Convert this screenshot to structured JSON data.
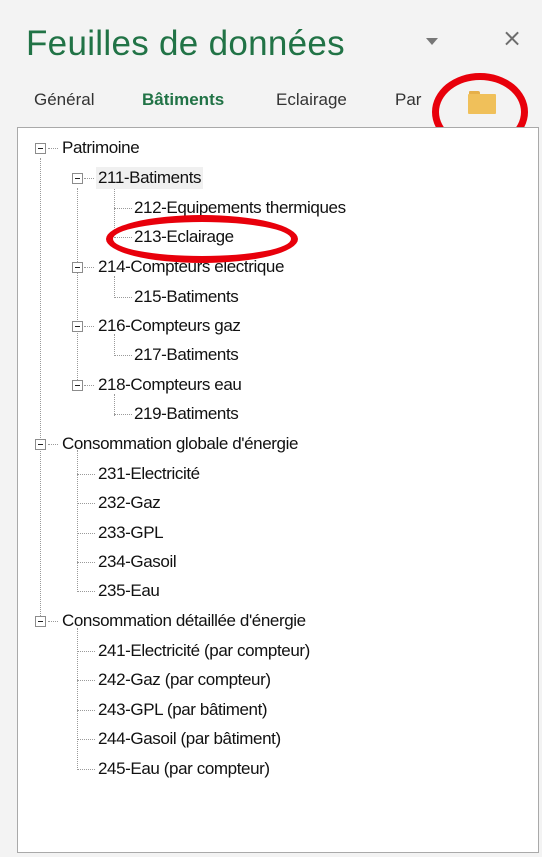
{
  "pane": {
    "title": "Feuilles de données",
    "dropdown_icon": "chevron-down-icon",
    "close_label": "×"
  },
  "tabs": [
    {
      "label": "Général",
      "active": false
    },
    {
      "label": "Bâtiments",
      "active": true
    },
    {
      "label": "Eclairage",
      "active": false
    },
    {
      "label": "Par",
      "active": false
    }
  ],
  "folder_icon": "folder-icon",
  "tree": {
    "groups": [
      {
        "label": "Patrimoine",
        "children": [
          {
            "label": "211-Batiments",
            "selected": true,
            "children": [
              "212-Equipements thermiques",
              "213-Eclairage"
            ]
          },
          {
            "label": "214-Compteurs électrique",
            "children": [
              "215-Batiments"
            ]
          },
          {
            "label": "216-Compteurs gaz",
            "children": [
              "217-Batiments"
            ]
          },
          {
            "label": "218-Compteurs eau",
            "children": [
              "219-Batiments"
            ]
          }
        ]
      },
      {
        "label": "Consommation globale d'énergie",
        "children": [
          "231-Electricité",
          "232-Gaz",
          "233-GPL",
          "234-Gasoil",
          "235-Eau"
        ]
      },
      {
        "label": "Consommation détaillée d'énergie",
        "children": [
          "241-Electricité (par compteur)",
          "242-Gaz (par compteur)",
          "243-GPL (par bâtiment)",
          "244-Gasoil (par bâtiment)",
          "245-Eau (par compteur)"
        ]
      }
    ]
  },
  "colors": {
    "accent": "#217346",
    "annotation": "#e8000b",
    "folder": "#f0c05a"
  }
}
